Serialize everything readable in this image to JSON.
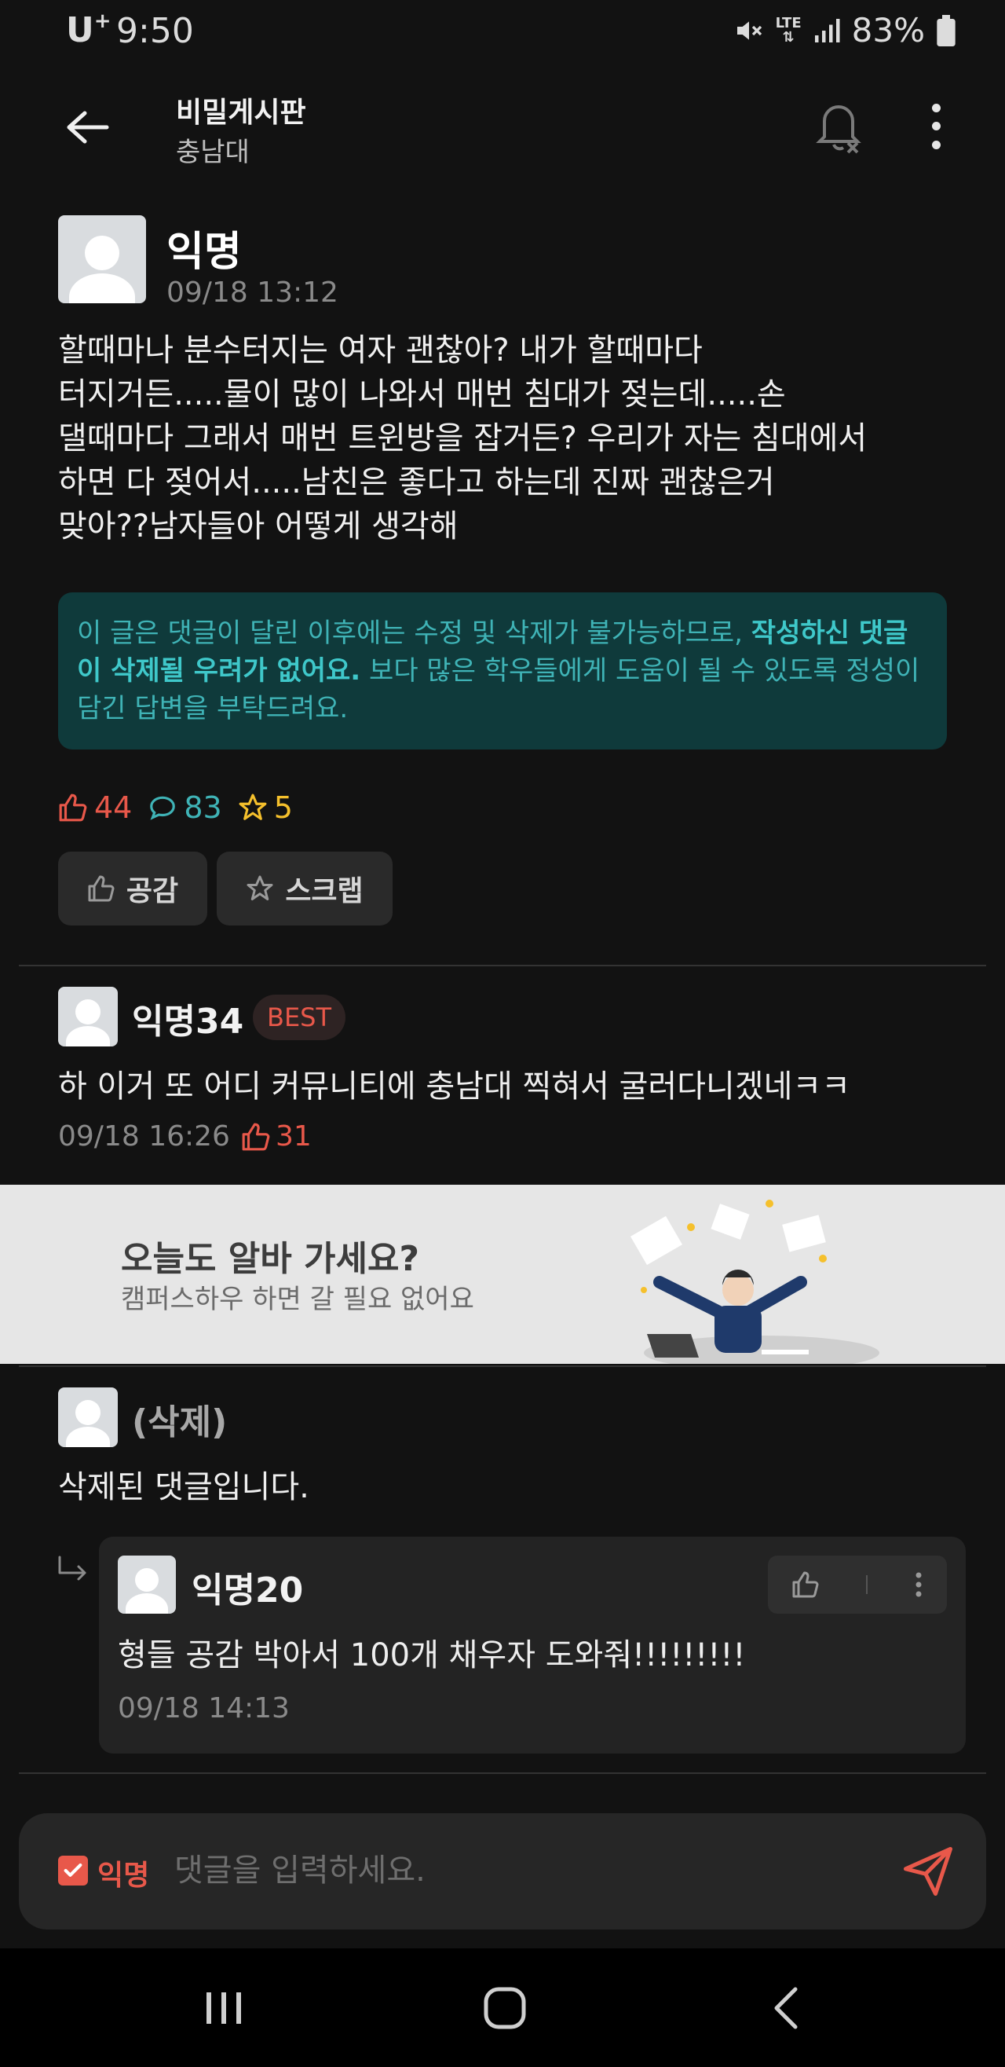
{
  "status_bar": {
    "carrier": "U",
    "carrier_sup": "+",
    "time": "9:50",
    "network_top": "LTE",
    "network_bottom": "⇅",
    "battery": "83%"
  },
  "app_bar": {
    "title": "비밀게시판",
    "subtitle": "충남대"
  },
  "post": {
    "author": "익명",
    "time": "09/18 13:12",
    "body": "할때마나 분수터지는 여자 괜찮아? 내가 할때마다\n터지거든.....물이 많이 나와서 매번 침대가 젖는데.....손\n댈때마다 그래서 매번 트윈방을 잡거든? 우리가 자는 침대에서\n하면 다 젖어서.....남친은 좋다고 하는데 진짜 괜찮은거\n맞아??남자들아 어떻게 생각해",
    "notice_part1": "이 글은 댓글이 달린 이후에는 수정 및 삭제가 불가능하므로, ",
    "notice_bold": "작성하신 댓글이 삭제될 우려가 없어요.",
    "notice_part2": " 보다 많은 학우들에게 도움이 될 수 있도록 정성이 담긴 답변을 부탁드려요.",
    "likes": "44",
    "comments": "83",
    "scraps": "5",
    "like_button": "공감",
    "scrap_button": "스크랩"
  },
  "comments": [
    {
      "author": "익명34",
      "badge": "BEST",
      "text": "하 이거 또 어디 커뮤니티에 충남대 찍혀서 굴러다니겠네ㅋㅋ",
      "time": "09/18 16:26",
      "likes": "31"
    },
    {
      "author": "(삭제)",
      "text": "삭제된 댓글입니다.",
      "reply": {
        "author": "익명20",
        "text": "형들 공감 박아서 100개 채우자 도와줘!!!!!!!!!",
        "time": "09/18 14:13"
      }
    }
  ],
  "ad": {
    "title": "오늘도 알바 가세요?",
    "subtitle": "캠퍼스하우 하면 갈 필요 없어요"
  },
  "input_bar": {
    "anon_label": "익명",
    "placeholder": "댓글을 입력하세요."
  },
  "colors": {
    "background": "#121212",
    "accent_red": "#e8584a",
    "accent_teal": "#3fb3b6",
    "accent_yellow": "#f5c02c",
    "notice_bg": "#0f3a3b"
  },
  "icons": {
    "back": "arrow-left-icon",
    "bell": "bell-off-icon",
    "more": "more-vertical-icon",
    "like": "thumbs-up-icon",
    "comment": "comment-icon",
    "scrap": "star-icon",
    "send": "send-icon"
  }
}
